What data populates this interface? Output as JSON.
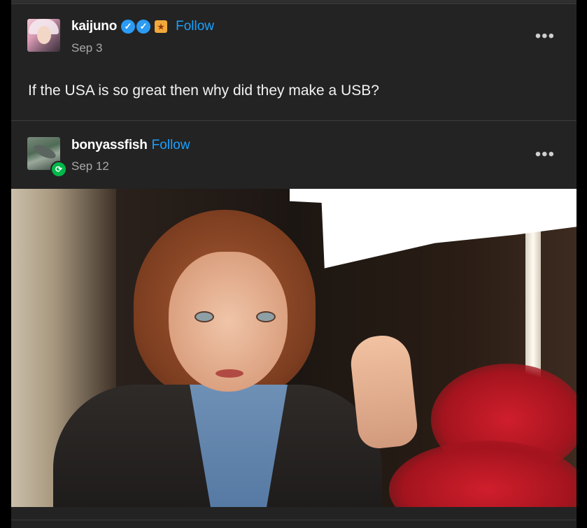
{
  "post": {
    "author": "kaijuno",
    "date": "Sep 3",
    "follow_label": "Follow",
    "more_label": "•••",
    "text": "If the USA is so great then why did they make a USB?",
    "badges": [
      "verified-check-icon",
      "verified-check-icon",
      "gift-icon"
    ]
  },
  "reblog": {
    "author": "bonyassfish",
    "date": "Sep 12",
    "follow_label": "Follow",
    "more_label": "•••"
  },
  "colors": {
    "background": "#232323",
    "follow": "#1aa1ff",
    "date": "#a8a8a8",
    "reblog_badge": "#00b84a"
  }
}
